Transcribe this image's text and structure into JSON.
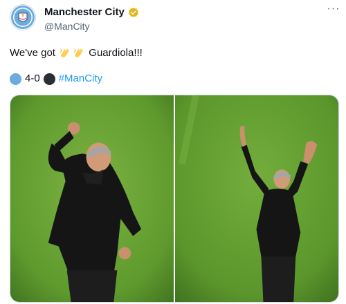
{
  "account": {
    "display_name": "Manchester City",
    "handle": "@ManCity",
    "verified_icon": "gold-verified-badge-icon",
    "avatar_icon": "manchester-city-crest-icon"
  },
  "menu": {
    "more_label": "···"
  },
  "tweet": {
    "text_before": "We've got ",
    "emoji": [
      "clapping-hands-icon",
      "clapping-hands-icon"
    ],
    "text_after": " Guardiola!!!",
    "score": "4-0",
    "hashtag": "#ManCity"
  },
  "colors": {
    "accent_blue": "#1d9bf0",
    "city_blue": "#6cabdd",
    "verified_gold": "#e2b719",
    "pitch_green": "#5f9a2e"
  },
  "media": {
    "photos": [
      {
        "icon": "celebrating-manager-fist-pump-photo"
      },
      {
        "icon": "celebrating-manager-arms-raised-photo"
      }
    ]
  }
}
